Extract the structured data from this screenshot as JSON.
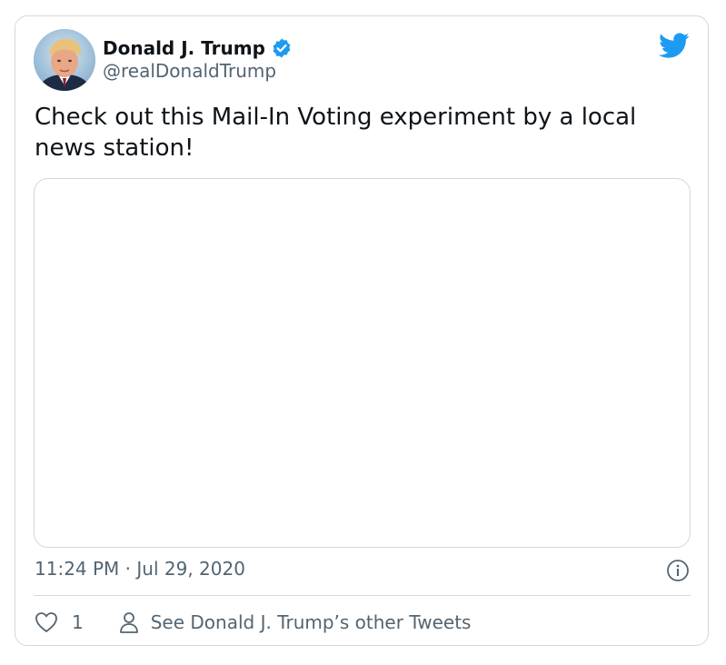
{
  "tweet": {
    "author": {
      "display_name": "Donald J. Trump",
      "handle": "@realDonaldTrump",
      "verified": true,
      "avatar_icon": "avatar-photo"
    },
    "text": "Check out this Mail-In Voting experiment by a local news station!",
    "timestamp": "11:24 PM · Jul 29, 2020",
    "likes": "1",
    "other_tweets_label": "See Donald J. Trump’s other Tweets"
  },
  "icons": {
    "brand": "twitter-bird-icon",
    "verified": "verified-badge-icon",
    "info": "info-icon",
    "like": "heart-icon",
    "person": "person-icon"
  },
  "colors": {
    "brand_blue": "#1d9bf0",
    "text_primary": "#0f1419",
    "text_secondary": "#536471",
    "border": "#cfd9de"
  }
}
